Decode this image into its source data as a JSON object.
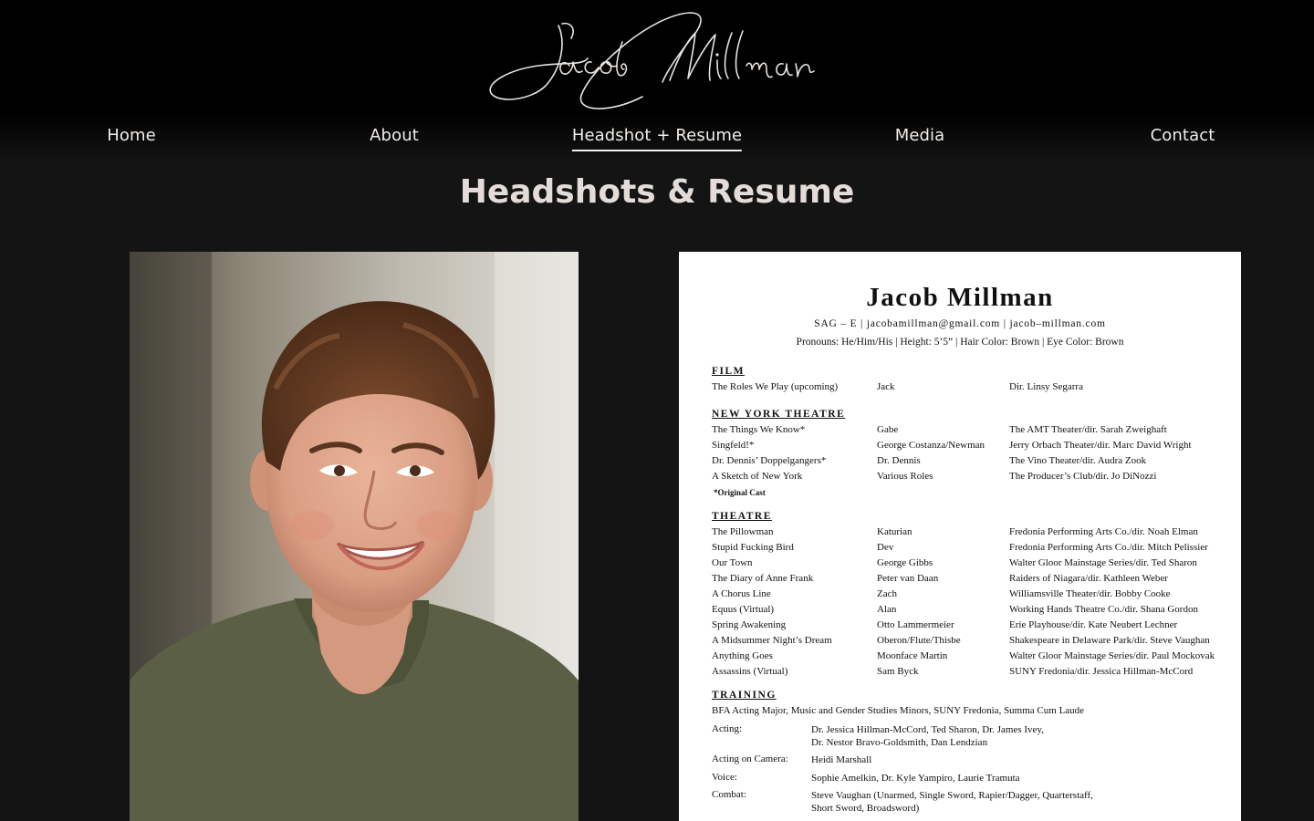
{
  "site": {
    "logo_text": "Jacob Millman"
  },
  "nav": {
    "items": [
      {
        "label": "Home",
        "active": false
      },
      {
        "label": "About",
        "active": false
      },
      {
        "label": "Headshot + Resume",
        "active": true
      },
      {
        "label": "Media",
        "active": false
      },
      {
        "label": "Contact",
        "active": false
      }
    ]
  },
  "page": {
    "title": "Headshots & Resume"
  },
  "resume": {
    "name": "Jacob Millman",
    "contact": "SAG – E  |  jacobamillman@gmail.com  |  jacob–millman.com",
    "details": "Pronouns: He/Him/His  |  Height: 5’5”  |  Hair Color: Brown  |  Eye Color: Brown",
    "film": {
      "heading": "FILM",
      "rows": [
        [
          "The Roles We Play (upcoming)",
          "Jack",
          "Dir. Linsy Segarra"
        ]
      ]
    },
    "ny_theatre": {
      "heading": "NEW YORK THEATRE",
      "rows": [
        [
          "The Things We Know*",
          "Gabe",
          "The AMT Theater/dir. Sarah Zweighaft"
        ],
        [
          "Singfeld!*",
          "George Costanza/Newman",
          "Jerry Orbach Theater/dir. Marc David Wright"
        ],
        [
          "Dr. Dennis’ Doppelgangers*",
          "Dr. Dennis",
          "The Vino Theater/dir. Audra Zook"
        ],
        [
          "A Sketch of New York",
          "Various Roles",
          "The Producer’s Club/dir. Jo DiNozzi"
        ]
      ],
      "note": "*Original Cast"
    },
    "theatre": {
      "heading": "THEATRE",
      "rows": [
        [
          "The Pillowman",
          "Katurian",
          "Fredonia Performing Arts Co./dir. Noah Elman"
        ],
        [
          "Stupid Fucking Bird",
          "Dev",
          "Fredonia Performing Arts Co./dir. Mitch Pelissier"
        ],
        [
          "Our Town",
          "George Gibbs",
          "Walter Gloor Mainstage Series/dir. Ted Sharon"
        ],
        [
          "The Diary of Anne Frank",
          "Peter van Daan",
          "Raiders of Niagara/dir. Kathleen Weber"
        ],
        [
          "A Chorus Line",
          "Zach",
          "Williamsville Theater/dir. Bobby Cooke"
        ],
        [
          "Equus (Virtual)",
          "Alan",
          "Working Hands Theatre Co./dir. Shana Gordon"
        ],
        [
          "Spring Awakening",
          "Otto Lammermeier",
          "Erie Playhouse/dir. Kate Neubert Lechner"
        ],
        [
          "A Midsummer Night’s Dream",
          "Oberon/Flute/Thisbe",
          "Shakespeare in Delaware Park/dir. Steve Vaughan"
        ],
        [
          "Anything Goes",
          "Moonface Martin",
          "Walter Gloor Mainstage Series/dir. Paul Mockovak"
        ],
        [
          "Assassins (Virtual)",
          "Sam Byck",
          "SUNY Fredonia/dir. Jessica Hillman-McCord"
        ]
      ]
    },
    "training": {
      "heading": "TRAINING",
      "degree": "BFA Acting Major, Music and Gender Studies Minors, SUNY Fredonia, Summa Cum Laude",
      "items": [
        {
          "label": "Acting:",
          "line1": "Dr. Jessica Hillman-McCord, Ted Sharon, Dr. James Ivey,",
          "line2": "Dr. Nestor Bravo-Goldsmith, Dan Lendzian"
        },
        {
          "label": "Acting on Camera:",
          "line1": "Heidi Marshall",
          "line2": ""
        },
        {
          "label": "Voice:",
          "line1": "Sophie Amelkin, Dr. Kyle Yampiro, Laurie Tramuta",
          "line2": ""
        },
        {
          "label": "Combat:",
          "line1": "Steve Vaughan (Unarmed, Single Sword, Rapier/Dagger, Quarterstaff,",
          "line2": "Short Sword, Broadsword)"
        }
      ]
    }
  }
}
